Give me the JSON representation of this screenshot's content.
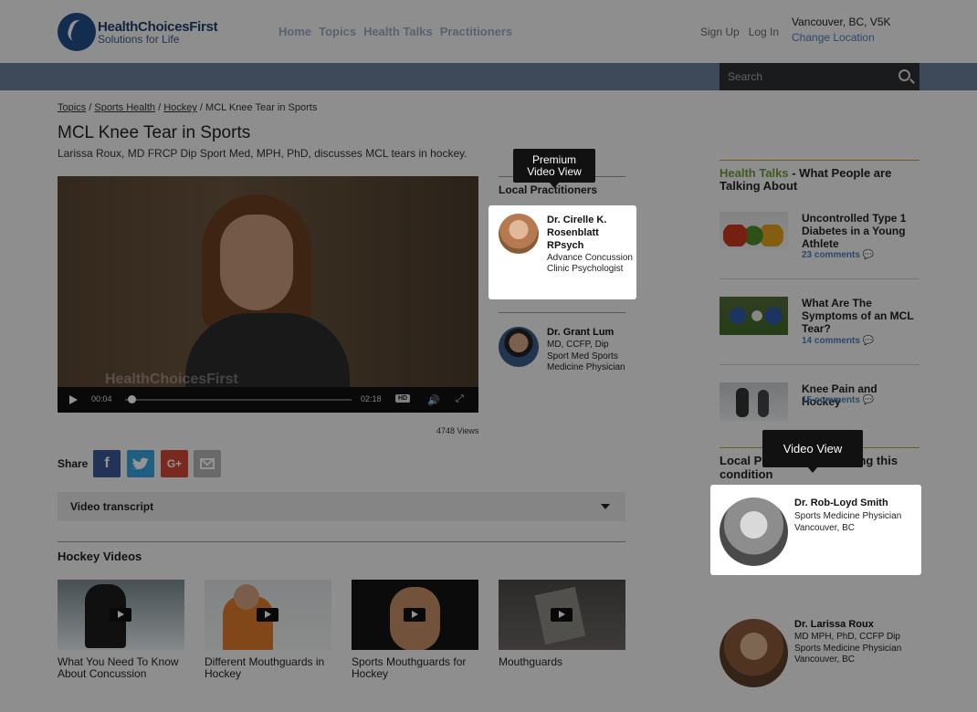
{
  "header": {
    "brand": "HealthChoicesFirst",
    "tagline": "Solutions for Life",
    "nav": [
      "Home",
      "Topics",
      "Health Talks",
      "Practitioners"
    ],
    "sign_up": "Sign Up",
    "log_in": "Log In",
    "location": "Vancouver, BC, V5K",
    "change_location": "Change Location",
    "search_placeholder": "Search"
  },
  "breadcrumb": [
    "Topics",
    "Sports Health",
    "Hockey",
    "MCL Knee Tear in Sports"
  ],
  "page": {
    "title": "MCL Knee Tear in Sports",
    "subtitle": "Larissa Roux, MD FRCP Dip Sport Med, MPH, PhD, discusses MCL tears in hockey."
  },
  "video": {
    "watermark": "HealthChoicesFirst",
    "current_time": "00:04",
    "duration": "02:18",
    "hd": "HD",
    "progress": 0.02,
    "views": "4748 Views"
  },
  "share": {
    "label": "Share",
    "facebook": "f",
    "google": "G+"
  },
  "transcript": {
    "label": "Video transcript"
  },
  "hockey_videos": {
    "title": "Hockey Videos",
    "items": [
      {
        "caption": "What You Need To Know About Concussion"
      },
      {
        "caption": "Different Mouthguards in Hockey"
      },
      {
        "caption": "Sports Mouthguards for Hockey"
      },
      {
        "caption": "Mouthguards"
      }
    ]
  },
  "local_practitioners": {
    "title": "Local Practitioners",
    "items": [
      {
        "name": "Dr. Cirelle K. Rosenblatt RPsych",
        "role": "Advance Concussion Clinic Psychologist"
      },
      {
        "name": "Dr. Grant Lum",
        "role": "MD, CCFP, Dip Sport Med Sports Medicine Physician"
      }
    ]
  },
  "health_talks": {
    "title_green": "Health Talks",
    "title_rest": " - What People are Talking About",
    "items": [
      {
        "title": "Uncontrolled Type 1 Diabetes in a Young Athlete",
        "comments": "23 comments"
      },
      {
        "title": "What Are The Symptoms of an MCL Tear?",
        "comments": "14 comments"
      },
      {
        "title": "Knee Pain and Hockey",
        "comments": "15 comments"
      }
    ]
  },
  "local_practitioners_condition": {
    "title": "Local Practitioners treating this condition",
    "items": [
      {
        "name": "Dr. Rob-Loyd Smith",
        "role": "Sports Medicine Physician",
        "location": "Vancouver, BC"
      },
      {
        "name": "Dr. Larissa Roux",
        "role": "MD MPH, PhD, CCFP Dip Sports Medicine Physician",
        "location": "Vancouver, BC"
      }
    ]
  },
  "tooltips": {
    "premium": "Premium Video View",
    "video": "Video View"
  },
  "colors": {
    "accent_blue": "#4a7fb8",
    "health_talks_green": "#6f9c3a",
    "facebook": "#3b5998",
    "twitter": "#3aa4e0",
    "google": "#d34836"
  }
}
